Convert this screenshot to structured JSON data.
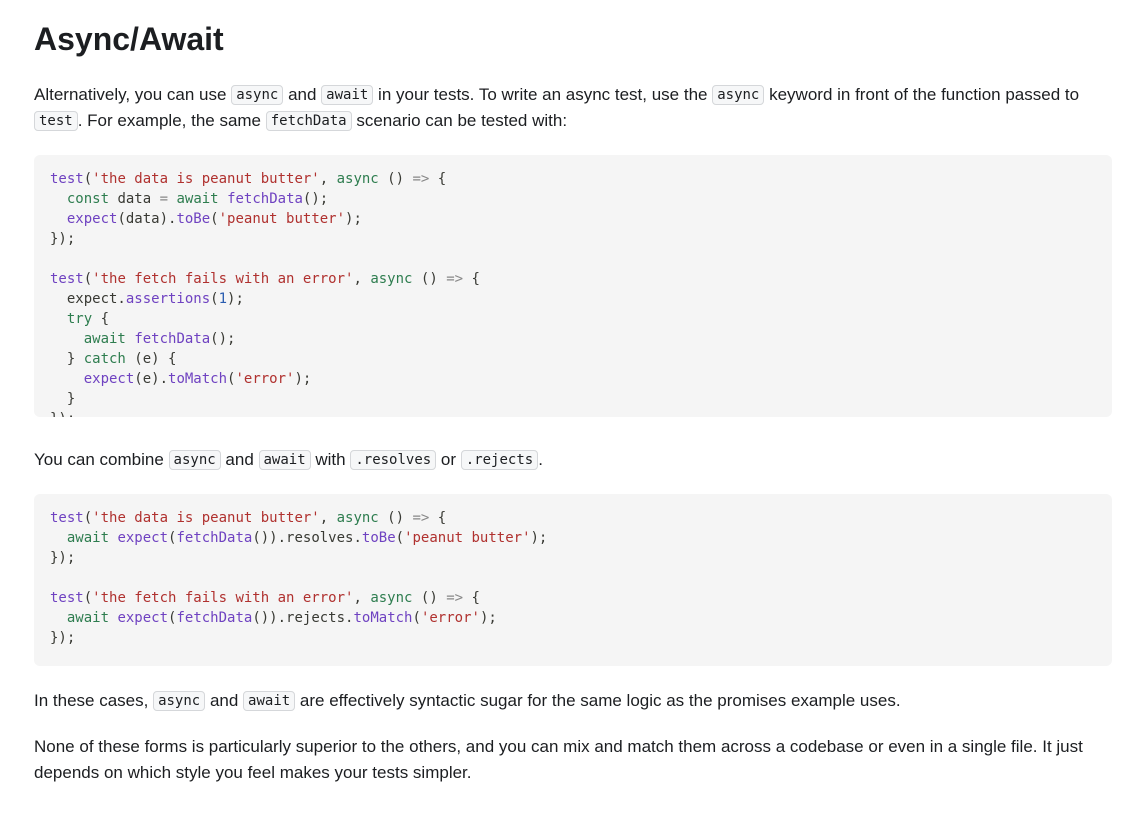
{
  "heading": "Async/Await",
  "para1": {
    "t1": "Alternatively, you can use ",
    "c1": "async",
    "t2": " and ",
    "c2": "await",
    "t3": " in your tests. To write an async test, use the ",
    "c3": "async",
    "t4": " keyword in front of the function passed to ",
    "c4": "test",
    "t5": ". For example, the same ",
    "c5": "fetchData",
    "t6": " scenario can be tested with:"
  },
  "code1": {
    "l1": {
      "a": "test",
      "b": "(",
      "c": "'the data is peanut butter'",
      "d": ", ",
      "e": "async",
      "f": " () ",
      "g": "=>",
      "h": " {"
    },
    "l2": {
      "a": "  ",
      "b": "const",
      "c": " data ",
      "d": "=",
      "e": " ",
      "f": "await",
      "g": " ",
      "h": "fetchData",
      "i": "();"
    },
    "l3": {
      "a": "  ",
      "b": "expect",
      "c": "(data).",
      "d": "toBe",
      "e": "(",
      "f": "'peanut butter'",
      "g": ");"
    },
    "l4": "});",
    "l6": {
      "a": "test",
      "b": "(",
      "c": "'the fetch fails with an error'",
      "d": ", ",
      "e": "async",
      "f": " () ",
      "g": "=>",
      "h": " {"
    },
    "l7": {
      "a": "  expect.",
      "b": "assertions",
      "c": "(",
      "d": "1",
      "e": ");"
    },
    "l8": {
      "a": "  ",
      "b": "try",
      "c": " {"
    },
    "l9": {
      "a": "    ",
      "b": "await",
      "c": " ",
      "d": "fetchData",
      "e": "();"
    },
    "l10": {
      "a": "  } ",
      "b": "catch",
      "c": " (e) {"
    },
    "l11": {
      "a": "    ",
      "b": "expect",
      "c": "(e).",
      "d": "toMatch",
      "e": "(",
      "f": "'error'",
      "g": ");"
    },
    "l12": "  }",
    "l13": "});"
  },
  "para2": {
    "t1": "You can combine ",
    "c1": "async",
    "t2": " and ",
    "c2": "await",
    "t3": " with ",
    "c3": ".resolves",
    "t4": " or ",
    "c4": ".rejects",
    "t5": "."
  },
  "code2": {
    "l1": {
      "a": "test",
      "b": "(",
      "c": "'the data is peanut butter'",
      "d": ", ",
      "e": "async",
      "f": " () ",
      "g": "=>",
      "h": " {"
    },
    "l2": {
      "a": "  ",
      "b": "await",
      "c": " ",
      "d": "expect",
      "e": "(",
      "f": "fetchData",
      "g": "()).resolves.",
      "h": "toBe",
      "i": "(",
      "j": "'peanut butter'",
      "k": ");"
    },
    "l3": "});",
    "l5": {
      "a": "test",
      "b": "(",
      "c": "'the fetch fails with an error'",
      "d": ", ",
      "e": "async",
      "f": " () ",
      "g": "=>",
      "h": " {"
    },
    "l6": {
      "a": "  ",
      "b": "await",
      "c": " ",
      "d": "expect",
      "e": "(",
      "f": "fetchData",
      "g": "()).rejects.",
      "h": "toMatch",
      "i": "(",
      "j": "'error'",
      "k": ");"
    },
    "l7": "});"
  },
  "para3": {
    "t1": "In these cases, ",
    "c1": "async",
    "t2": " and ",
    "c2": "await",
    "t3": " are effectively syntactic sugar for the same logic as the promises example uses."
  },
  "para4": "None of these forms is particularly superior to the others, and you can mix and match them across a codebase or even in a single file. It just depends on which style you feel makes your tests simpler."
}
